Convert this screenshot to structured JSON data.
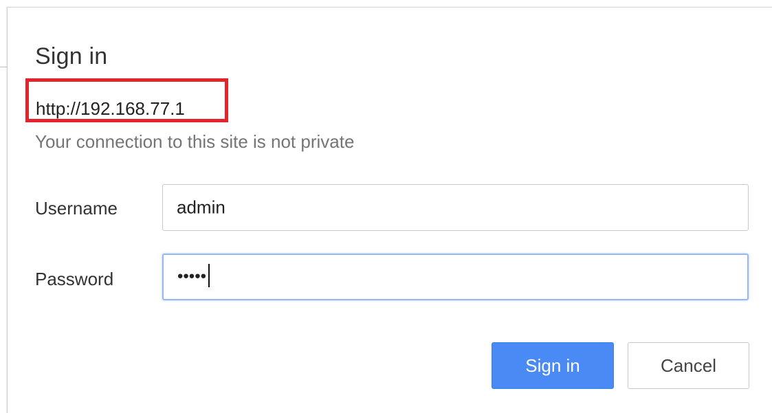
{
  "dialog": {
    "title": "Sign in",
    "origin": "http://192.168.77.1",
    "subtitle": "Your connection to this site is not private"
  },
  "form": {
    "username_label": "Username",
    "username_value": "admin",
    "password_label": "Password",
    "password_masked": "•••••"
  },
  "buttons": {
    "sign_in": "Sign in",
    "cancel": "Cancel"
  },
  "colors": {
    "highlight_box": "#e3242b",
    "primary_button": "#4a8af4",
    "focus_border": "#98b9ec"
  }
}
